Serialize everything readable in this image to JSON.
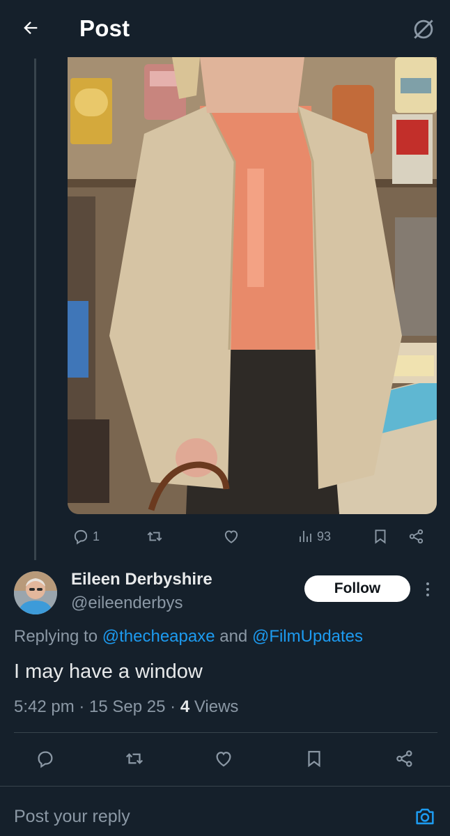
{
  "header": {
    "title": "Post",
    "back_icon": "arrow-left-icon",
    "right_icon": "grok-icon"
  },
  "parent_post": {
    "media_description_icon": "photo",
    "actions": {
      "replies": "1",
      "reposts": "",
      "likes": "",
      "views": "93"
    }
  },
  "reply": {
    "display_name": "Eileen Derbyshire",
    "handle": "@eileenderbys",
    "follow_label": "Follow",
    "replying_prefix": "Replying to ",
    "mention_1": "@thecheapaxe",
    "replying_join": " and ",
    "mention_2": "@FilmUpdates",
    "text": "I may have a window",
    "time": "5:42 pm",
    "sep1": " · ",
    "date": "15 Sep 25",
    "sep2": " · ",
    "views_count": "4",
    "views_label": " Views"
  },
  "composer": {
    "placeholder": "Post your reply"
  },
  "colors": {
    "background": "#15202b",
    "accent": "#1d9bf0",
    "muted": "#8b98a5",
    "divider": "#38444d"
  }
}
